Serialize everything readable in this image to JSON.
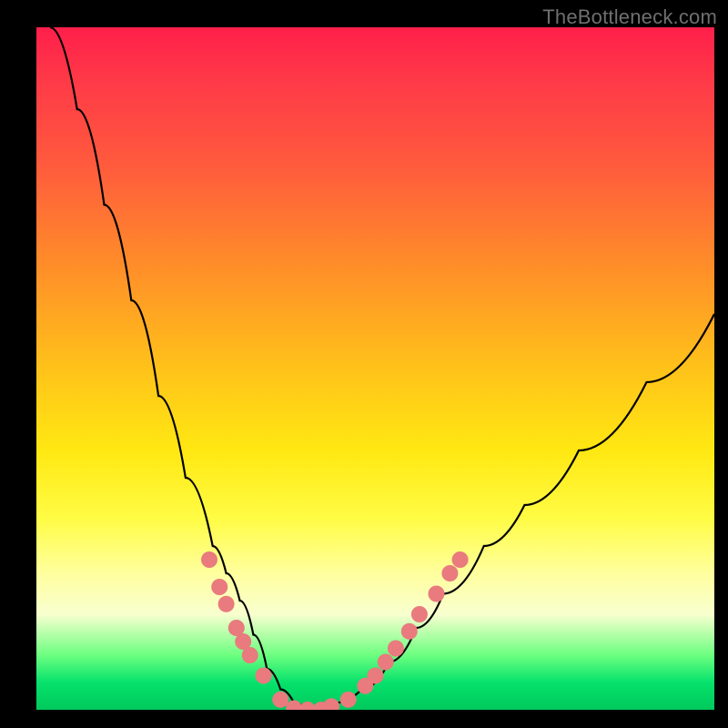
{
  "watermark": "TheBottleneck.com",
  "chart_data": {
    "type": "line",
    "title": "",
    "xlabel": "",
    "ylabel": "",
    "xlim": [
      0,
      100
    ],
    "ylim": [
      0,
      100
    ],
    "grid": false,
    "series": [
      {
        "name": "curve",
        "x": [
          2,
          6,
          10,
          14,
          18,
          22,
          26,
          28,
          30,
          32,
          34,
          36,
          38,
          40,
          42,
          44,
          48,
          52,
          56,
          60,
          66,
          72,
          80,
          90,
          100
        ],
        "y": [
          100,
          88,
          74,
          60,
          46,
          34,
          24,
          20,
          16,
          11,
          6,
          3,
          1,
          0,
          0,
          1,
          3,
          7,
          12,
          17,
          24,
          30,
          38,
          48,
          58
        ]
      }
    ],
    "markers": [
      {
        "x": 25.5,
        "y": 22
      },
      {
        "x": 27,
        "y": 18
      },
      {
        "x": 28,
        "y": 15.5
      },
      {
        "x": 29.5,
        "y": 12
      },
      {
        "x": 30.5,
        "y": 10
      },
      {
        "x": 31.5,
        "y": 8
      },
      {
        "x": 33.5,
        "y": 5
      },
      {
        "x": 36,
        "y": 1.5
      },
      {
        "x": 38,
        "y": 0.2
      },
      {
        "x": 40,
        "y": 0
      },
      {
        "x": 42,
        "y": 0
      },
      {
        "x": 43.5,
        "y": 0.5
      },
      {
        "x": 46,
        "y": 1.5
      },
      {
        "x": 48.5,
        "y": 3.5
      },
      {
        "x": 50,
        "y": 5
      },
      {
        "x": 51.5,
        "y": 7
      },
      {
        "x": 53,
        "y": 9
      },
      {
        "x": 55,
        "y": 11.5
      },
      {
        "x": 56.5,
        "y": 14
      },
      {
        "x": 59,
        "y": 17
      },
      {
        "x": 61,
        "y": 20
      },
      {
        "x": 62.5,
        "y": 22
      }
    ],
    "marker_color": "#e97a7e",
    "curve_color": "#000000",
    "marker_radius_px": 9
  }
}
